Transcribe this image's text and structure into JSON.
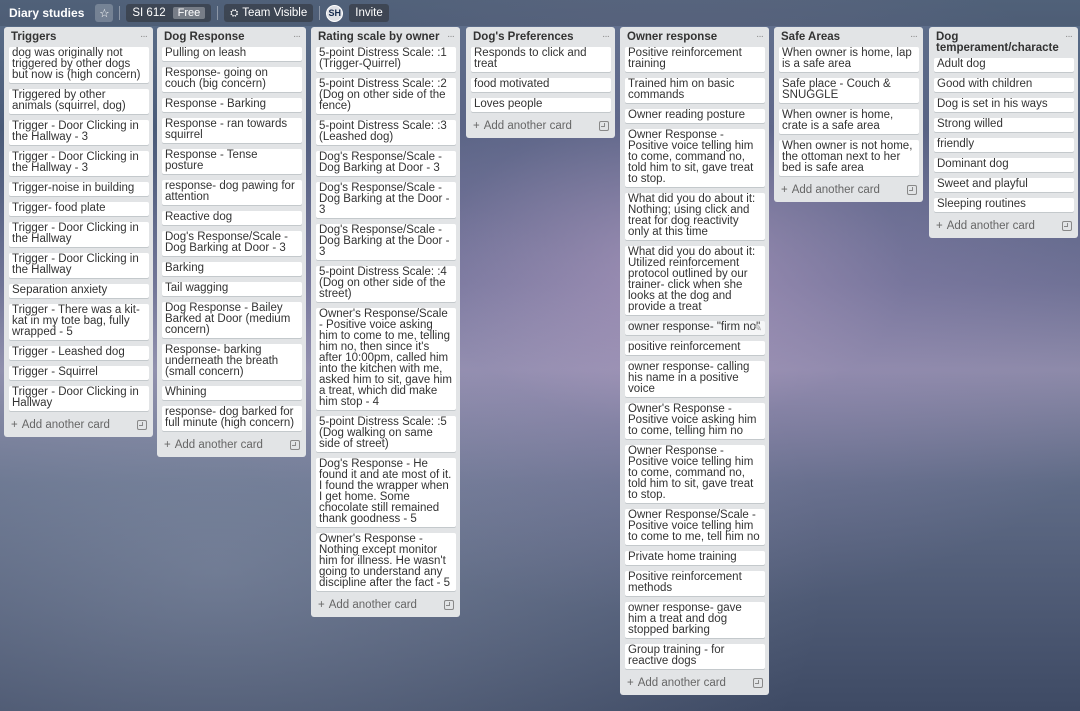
{
  "board": {
    "title": "Diary studies",
    "workspace_name": "SI 612",
    "workspace_tier": "Free",
    "visibility": "Team Visible",
    "member_initials": "SH",
    "invite_label": "Invite",
    "star_icon": "☆",
    "lock_icon": "⛭",
    "add_card_label": "Add another card",
    "list_menu_icon": "···",
    "plus_icon": "+"
  },
  "lists": [
    {
      "title": "Triggers",
      "cards": [
        "dog was originally not triggered by other dogs but now is (high concern)",
        "Triggered by other animals (squirrel, dog)",
        "Trigger - Door Clicking in the Hallway - 3",
        "Trigger - Door Clicking in the Hallway - 3",
        "Trigger-noise in building",
        "Trigger- food plate",
        "Trigger - Door Clicking in the Hallway",
        "Trigger - Door Clicking in the Hallway",
        "Separation anxiety",
        "Trigger - There was a kit-kat in my tote bag, fully wrapped - 5",
        "Trigger - Leashed dog",
        "Trigger - Squirrel",
        "Trigger - Door Clicking in Hallway"
      ]
    },
    {
      "title": "Dog Response",
      "cards": [
        "Pulling on leash",
        "Response- going on couch (big concern)",
        "Response - Barking",
        "Response - ran towards squirrel",
        "Response - Tense posture",
        "response- dog pawing for attention",
        "Reactive dog",
        "Dog's Response/Scale - Dog Barking at Door - 3",
        "Barking",
        "Tail wagging",
        "Dog Response - Bailey Barked at Door (medium concern)",
        "Response- barking underneath the breath (small concern)",
        "Whining",
        "response- dog barked for full minute (high concern)"
      ]
    },
    {
      "title": "Rating scale by owner",
      "cards": [
        "5-point Distress Scale: :1 (Trigger-Quirrel)",
        "5-point Distress Scale: :2 (Dog on other side of the fence)",
        "5-point Distress Scale: :3 (Leashed dog)",
        "Dog's Response/Scale - Dog Barking at Door - 3",
        "Dog's Response/Scale - Dog Barking at the Door - 3",
        "Dog's Response/Scale - Dog Barking at the Door - 3",
        "5-point Distress Scale: :4 (Dog on other side of the street)",
        "Owner's Response/Scale - Positive voice asking him to come to me, telling him no, then since it's after 10:00pm, called him into the kitchen with me, asked him to sit, gave him a treat, which did make him stop - 4",
        "5-point Distress Scale: :5 (Dog walking on same side of street)",
        "Dog's Response - He found it and ate most of it. I found the wrapper when I get home. Some chocolate still remained thank goodness - 5",
        "Owner's Response - Nothing except monitor him for illness. He wasn't going to understand any discipline after the fact - 5"
      ]
    },
    {
      "title": "Dog's Preferences",
      "cards": [
        "Responds to click and treat",
        "food motivated",
        "Loves people"
      ]
    },
    {
      "title": "Owner response",
      "cards": [
        "Positive reinforcement training",
        "Trained him on basic commands",
        "Owner reading posture",
        "Owner Response - Positive voice telling him to come, command no, told him to sit, gave treat to stop.",
        "What did you do about it: Nothing; using click and treat for dog reactivity only at this time",
        "What did you do about it: Utilized reinforcement protocol outlined by our trainer- click when she looks at the dog and provide a treat",
        "owner response- \"firm no\"",
        "positive reinforcement",
        "owner response- calling his name in a positive voice",
        "Owner's Response - Positive voice asking him to come, telling him no",
        "Owner Response - Positive voice telling him to come, command no, told him to sit, gave treat to stop.",
        "Owner Response/Scale - Positive voice telling him to come to me, tell him no",
        "Private home training",
        "Positive reinforcement methods",
        "owner response- gave him a treat and dog stopped barking",
        "Group training - for reactive dogs"
      ]
    },
    {
      "title": "Safe Areas",
      "cards": [
        "When owner is home, lap is a safe area",
        "Safe place - Couch & SNUGGLE",
        "When owner is home, crate is a safe area",
        "When owner is not home, the ottoman next to her bed is safe area"
      ]
    },
    {
      "title": "Dog temperament/characte",
      "cards": [
        "Adult dog",
        "Good with children",
        "Dog is set in his ways",
        "Strong willed",
        "friendly",
        "Dominant dog",
        "Sweet and playful",
        "Sleeping routines"
      ]
    }
  ]
}
